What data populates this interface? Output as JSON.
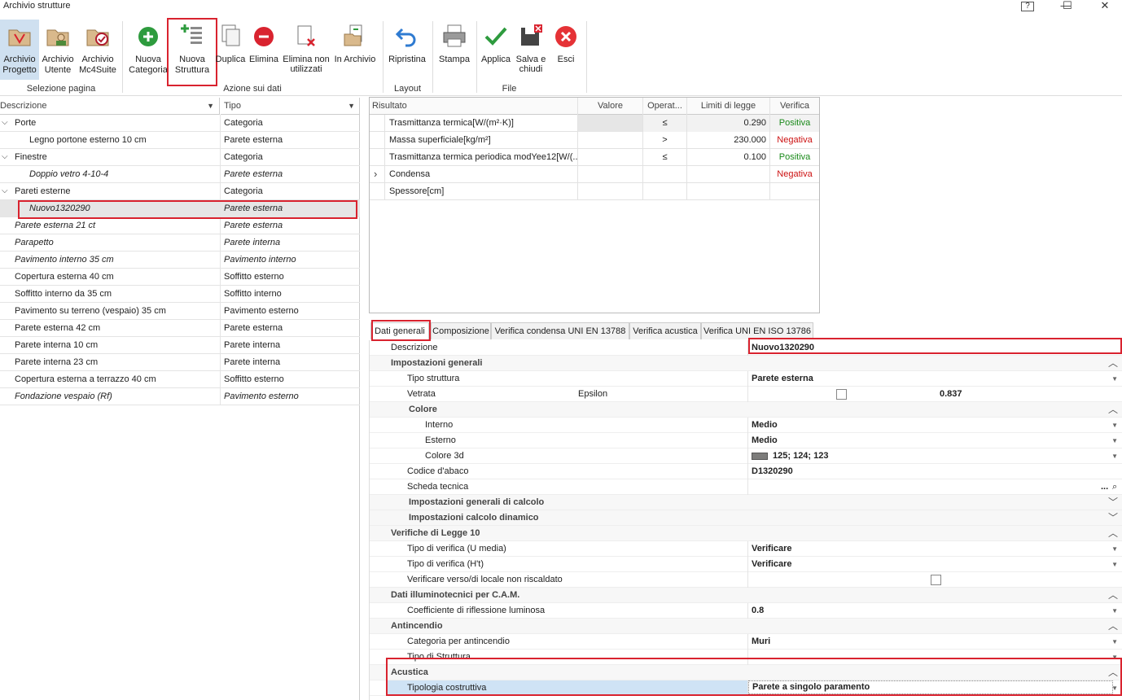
{
  "app": {
    "title": "Archivio strutture",
    "help": "?",
    "minimize": "—",
    "maximize": "☐",
    "close": "✕"
  },
  "ribbon": {
    "buttons": {
      "archivio_progetto": "Archivio Progetto",
      "archivio_utente": "Archivio Utente",
      "archivio_mc4suite": "Archivio Mc4Suite",
      "nuova_categoria": "Nuova Categoria",
      "nuova_struttura": "Nuova Struttura",
      "duplica": "Duplica",
      "elimina": "Elimina",
      "elimina_non_utilizzati": "Elimina non utilizzati",
      "in_archivio": "In Archivio",
      "ripristina": "Ripristina",
      "stampa": "Stampa",
      "applica": "Applica",
      "salva_e_chiudi": "Salva e chiudi",
      "esci": "Esci"
    },
    "groups": {
      "selezione_pagina": "Selezione pagina",
      "azione_sui_dati": "Azione sui dati",
      "layout": "Layout",
      "file": "File"
    }
  },
  "left_grid": {
    "headers": {
      "descrizione": "Descrizione",
      "tipo": "Tipo"
    },
    "rows": [
      {
        "desc": "Porte",
        "tipo": "Categoria"
      },
      {
        "desc": "Legno portone esterno 10 cm",
        "tipo": "Parete esterna"
      },
      {
        "desc": "Finestre",
        "tipo": "Categoria"
      },
      {
        "desc": "Doppio vetro 4-10-4",
        "tipo": "Parete esterna"
      },
      {
        "desc": "Pareti esterne",
        "tipo": "Categoria"
      },
      {
        "desc": "Nuovo1320290",
        "tipo": "Parete esterna"
      },
      {
        "desc": "Parete esterna 21 ct",
        "tipo": "Parete esterna"
      },
      {
        "desc": "Parapetto",
        "tipo": "Parete interna"
      },
      {
        "desc": "Pavimento interno 35 cm",
        "tipo": "Pavimento interno"
      },
      {
        "desc": "Copertura esterna 40 cm",
        "tipo": "Soffitto esterno"
      },
      {
        "desc": "Soffitto interno da 35 cm",
        "tipo": "Soffitto interno"
      },
      {
        "desc": "Pavimento su terreno (vespaio) 35 cm",
        "tipo": "Pavimento esterno"
      },
      {
        "desc": "Parete esterna 42 cm",
        "tipo": "Parete esterna"
      },
      {
        "desc": "Parete interna 10 cm",
        "tipo": "Parete interna"
      },
      {
        "desc": "Parete interna 23 cm",
        "tipo": "Parete interna"
      },
      {
        "desc": "Copertura esterna a terrazzo 40 cm",
        "tipo": "Soffitto esterno"
      },
      {
        "desc": "Fondazione vespaio (Rf)",
        "tipo": "Pavimento esterno"
      }
    ]
  },
  "result_grid": {
    "headers": {
      "risultato": "Risultato",
      "valore": "Valore",
      "operatore": "Operat...",
      "limiti": "Limiti di legge",
      "verifica": "Verifica"
    },
    "rows": [
      {
        "risultato": "Trasmittanza termica[W/(m²·K)]",
        "valore": "",
        "op": "≤",
        "limite": "0.290",
        "verifica": "Positiva"
      },
      {
        "risultato": "Massa superficiale[kg/m²]",
        "valore": "",
        "op": ">",
        "limite": "230.000",
        "verifica": "Negativa"
      },
      {
        "risultato": "Trasmittanza termica periodica modYee12[W/(...",
        "valore": "",
        "op": "≤",
        "limite": "0.100",
        "verifica": "Positiva"
      },
      {
        "risultato": "Condensa",
        "valore": "",
        "op": "",
        "limite": "",
        "verifica": "Negativa"
      },
      {
        "risultato": "Spessore[cm]",
        "valore": "",
        "op": "",
        "limite": "",
        "verifica": ""
      }
    ],
    "expand_glyph": "›"
  },
  "tabs": {
    "dati_generali": "Dati generali",
    "composizione": "Composizione",
    "verifica_condensa": "Verifica condensa  UNI EN 13788",
    "verifica_acustica": "Verifica acustica",
    "verifica_uni": "Verifica UNI EN ISO 13786"
  },
  "props": {
    "descrizione_label": "Descrizione",
    "descrizione_val": "Nuovo1320290",
    "impostazioni_generali": "Impostazioni generali",
    "tipo_struttura_label": "Tipo struttura",
    "tipo_struttura_val": "Parete esterna",
    "vetrata_label": "Vetrata",
    "epsilon_label": "Epsilon",
    "epsilon_val": "0.837",
    "colore": "Colore",
    "interno_label": "Interno",
    "interno_val": "Medio",
    "esterno_label": "Esterno",
    "esterno_val": "Medio",
    "colore3d_label": "Colore 3d",
    "colore3d_val": "125; 124; 123",
    "codice_label": "Codice d'abaco",
    "codice_val": "D1320290",
    "scheda_label": "Scheda tecnica",
    "scheda_btn": "...",
    "scheda_search": "⌕",
    "calcolo": "Impostazioni generali di calcolo",
    "dinamico": "Impostazioni calcolo dinamico",
    "legge10": "Verifiche di Legge 10",
    "verifica_u_label": "Tipo di verifica (U media)",
    "verifica_u_val": "Verificare",
    "verifica_h_label": "Tipo di verifica (H't)",
    "verifica_h_val": "Verificare",
    "non_riscaldato_label": "Verificare verso/di locale non riscaldato",
    "illuminotecnici": "Dati illuminotecnici per C.A.M.",
    "riflessione_label": "Coefficiente di riflessione luminosa",
    "riflessione_val": "0.8",
    "antincendio": "Antincendio",
    "cat_antincendio_label": "Categoria per antincendio",
    "cat_antincendio_val": "Muri",
    "tipo_di_struttura_label": "Tipo di Struttura",
    "acustica": "Acustica",
    "tipologia_label": "Tipologia costruttiva",
    "tipologia_val": "Parete a singolo paramento"
  },
  "colors": {
    "highlight_red": "#d9232f",
    "positive": "#1a8a1a",
    "negative": "#cc1111",
    "selection": "#cfe3f5",
    "swatch": "#7d7c7b"
  }
}
